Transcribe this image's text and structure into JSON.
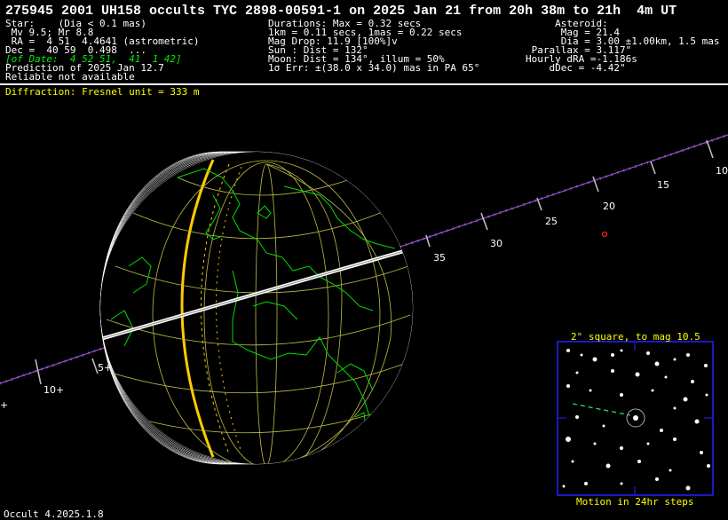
{
  "title": "275945 2001 UH158 occults TYC 2898-00591-1 on 2025 Jan 21 from 20h 38m to 21h  4m UT",
  "star_lines": [
    "Star:    (Dia < 0.1 mas)",
    " Mv 9.5; Mr 8.8",
    " RA =  4 51  4.4641 (astrometric)",
    "Dec =  40 59  0.498  ...",
    "[of Date:  4 52 51,  41  1 42]",
    "Prediction of 2025 Jan 12.7",
    "Reliable not available"
  ],
  "durations_lines": [
    "Durations: Max = 0.32 secs",
    "1km = 0.11 secs, 1mas = 0.22 secs",
    "Mag Drop: 11.9 [100%]v",
    "Sun : Dist = 132°",
    "Moon: Dist = 134°, illum = 50%",
    "1σ Err: ±(38.0 x 34.0) mas in PA 65°"
  ],
  "asteroid_lines": [
    "     Asteroid:",
    "      Mag = 21.4",
    "      Dia = 3.00 ±1.00km, 1.5 mas",
    " Parallax = 3.117\"",
    "Hourly dRA =-1.186s",
    "    dDec = -4.42\""
  ],
  "diffraction": "Diffraction: Fresnel unit = 333 m",
  "track_labels": [
    "10",
    "15",
    "20",
    "25",
    "30",
    "35",
    "5+",
    "10+",
    "+"
  ],
  "inset": {
    "title": "2° square, to mag 10.5",
    "caption": "Motion in 24hr steps"
  },
  "footer": "Occult 4.2025.1.8",
  "colors": {
    "background": "#000000",
    "text": "#ffffff",
    "highlight": "#ffff00",
    "coastline": "#00dd00",
    "grid": "#bdbd45",
    "track": "#9a4fd0",
    "inset_border": "#2222ff"
  }
}
